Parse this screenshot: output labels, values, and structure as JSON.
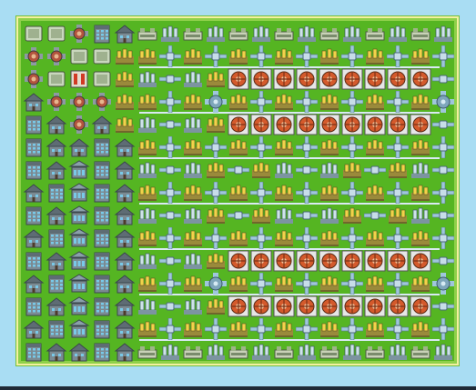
{
  "scene": {
    "colors": {
      "water": "#a9ddf3",
      "grass": "#55b522",
      "shore": "#f3f0a0",
      "building": "#7b8a92",
      "roof": "#5e6c74",
      "window": "#79c9e8",
      "pipe": "#9fc6dc",
      "farm": "#f2d34a",
      "hub": "#e6e6e6",
      "hub_core": "#d45a2c"
    },
    "tile_types": {
      "tower": "apartment-tower-icon",
      "house": "house-icon",
      "bank": "bank-icon",
      "crate": "container-icon",
      "splitter": "splitter-node-icon",
      "red": "red-generator-icon",
      "farm": "crop-plot-icon",
      "water": "water-pump-icon",
      "hub": "fan-hub-icon",
      "pipe": "pipe-junction-icon",
      "bench": "storage-shed-icon"
    }
  }
}
